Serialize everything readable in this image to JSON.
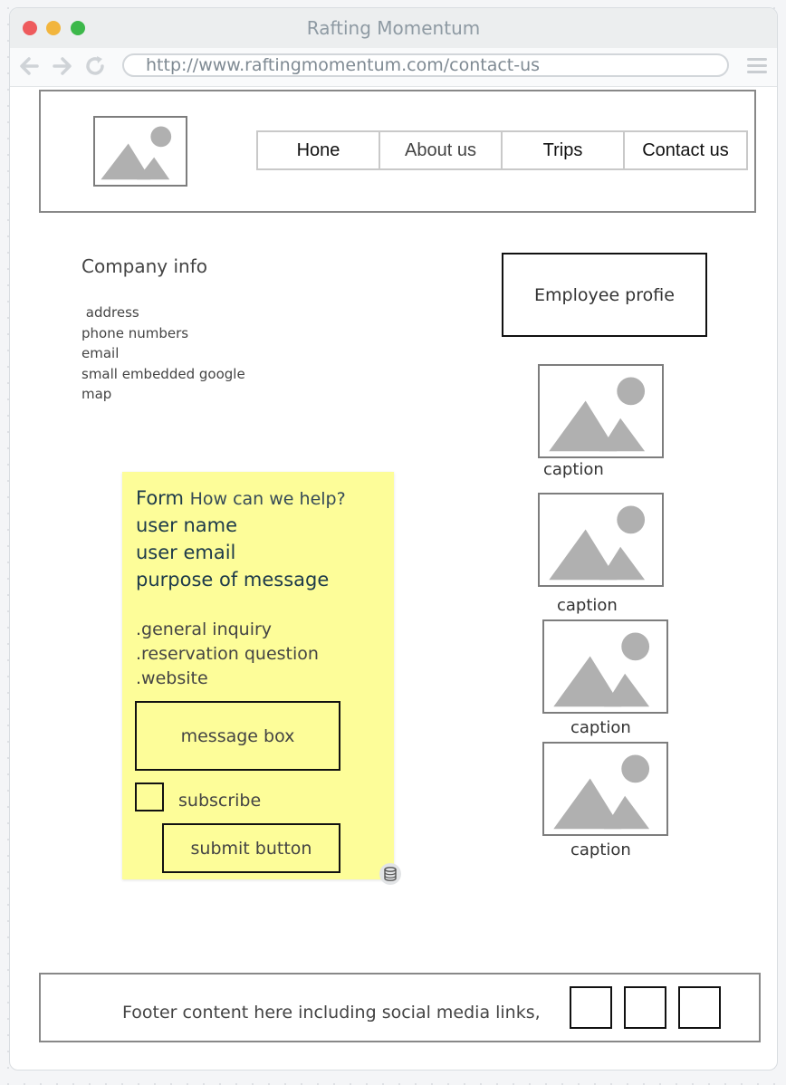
{
  "browser": {
    "title": "Rafting Momentum",
    "url": "http://www.raftingmomentum.com/contact-us",
    "controls": [
      "close",
      "minimize",
      "zoom"
    ],
    "colors": {
      "close": "#ee5b5d",
      "minimize": "#f2b53d",
      "zoom": "#3cb84a"
    }
  },
  "header": {
    "logo": "image-placeholder",
    "nav": [
      "Hone",
      "About us",
      "Trips",
      "Contact us"
    ]
  },
  "company": {
    "title": "Company info",
    "lines": [
      " address",
      "phone numbers",
      "email",
      "small embedded google",
      "map"
    ]
  },
  "form_note": {
    "title": "Form",
    "subtitle": "How can we help?",
    "fields": [
      "user name",
      "user email",
      "purpose of message"
    ],
    "options": [
      ".general inquiry",
      ".reservation question",
      ".website"
    ],
    "message_box": "message box",
    "subscribe": "subscribe",
    "submit": "submit button",
    "background": "#fdfd99"
  },
  "employee": {
    "title": "Employee profie",
    "captions": [
      "caption",
      "caption",
      "caption",
      "caption"
    ]
  },
  "footer": {
    "text": "Footer content here including social media links,",
    "social_count": 3
  }
}
